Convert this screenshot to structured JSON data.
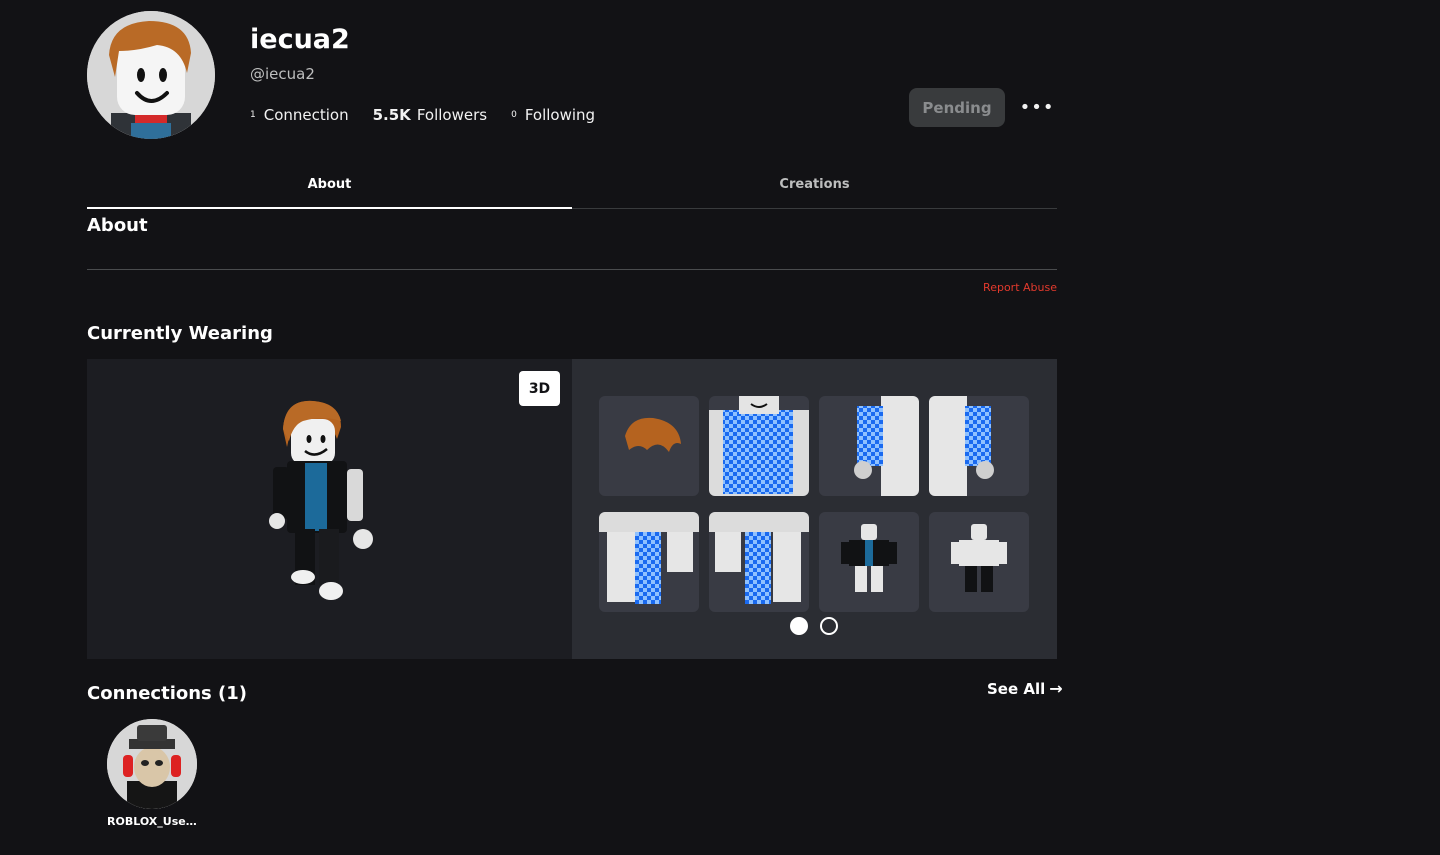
{
  "profile": {
    "display_name": "iecua2",
    "handle": "@iecua2",
    "connections_count": "1",
    "connections_label": "Connection",
    "followers_count": "5.5K",
    "followers_label": "Followers",
    "following_count": "0",
    "following_label": "Following",
    "pending_label": "Pending",
    "more_icon": "more-horizontal-icon"
  },
  "tabs": [
    {
      "label": "About",
      "active": true
    },
    {
      "label": "Creations",
      "active": false
    }
  ],
  "about": {
    "title": "About",
    "report_label": "Report Abuse"
  },
  "wearing": {
    "title": "Currently Wearing",
    "view_mode_label": "3D",
    "page_dots": [
      true,
      false
    ]
  },
  "connections": {
    "title": "Connections (1)",
    "see_all_label": "See All",
    "items": [
      {
        "name": "ROBLOX_User..."
      }
    ]
  }
}
